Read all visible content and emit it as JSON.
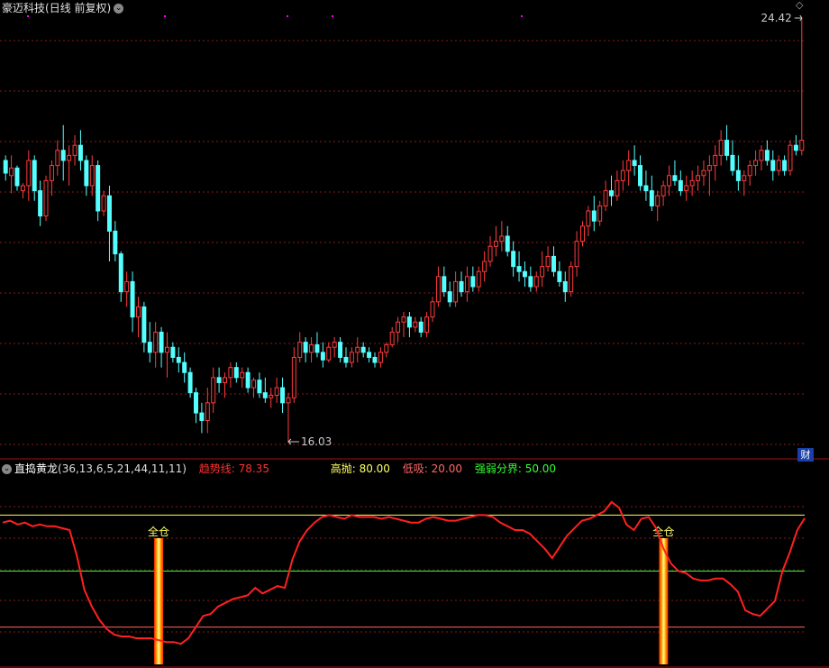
{
  "header": {
    "stock_name": "豪迈科技",
    "period_label": "(日线 前复权)",
    "dropdown_icon": "chevron-down-icon"
  },
  "price_chart": {
    "y_min": 16.03,
    "y_max": 24.42,
    "high_label": "24.42",
    "low_label": "16.03",
    "up_color": "#ff3b3b",
    "down_color": "#54ffff",
    "grid_color": "#8a1a1a",
    "magenta_marker_color": "#ff00ff",
    "fin_button_label": "财"
  },
  "indicator": {
    "name": "直捣黄龙",
    "params": "(36,13,6,5,21,44,11,11)",
    "trend_label": "趋势线:",
    "trend_value": "78.35",
    "high_label": "高抛:",
    "high_value": "80.00",
    "low_label": "低吸:",
    "low_value": "20.00",
    "mid_label": "强弱分界:",
    "mid_value": "50.00",
    "signal_label": "全仓",
    "trend_color": "#ff2020",
    "high_color": "#ffff66",
    "low_color": "#ff6666",
    "mid_color": "#33ff33"
  },
  "chart_data": {
    "type": "candlestick",
    "candles_ohlc": [
      [
        21.6,
        21.7,
        21.2,
        21.35
      ],
      [
        21.3,
        21.7,
        20.95,
        21.45
      ],
      [
        21.45,
        21.5,
        21.0,
        21.1
      ],
      [
        21.0,
        21.15,
        20.85,
        21.1
      ],
      [
        21.1,
        21.8,
        20.8,
        21.6
      ],
      [
        21.6,
        21.7,
        20.8,
        21.0
      ],
      [
        21.0,
        21.2,
        20.3,
        20.5
      ],
      [
        20.5,
        21.3,
        20.4,
        21.2
      ],
      [
        21.2,
        21.6,
        20.9,
        21.5
      ],
      [
        21.5,
        22.0,
        21.3,
        21.8
      ],
      [
        21.8,
        22.3,
        21.2,
        21.6
      ],
      [
        21.6,
        21.9,
        21.1,
        21.7
      ],
      [
        21.7,
        22.1,
        21.5,
        21.9
      ],
      [
        21.9,
        22.2,
        21.4,
        21.6
      ],
      [
        21.6,
        21.7,
        20.9,
        21.1
      ],
      [
        21.1,
        21.7,
        20.9,
        21.5
      ],
      [
        21.5,
        21.6,
        20.4,
        20.6
      ],
      [
        20.6,
        21.0,
        20.5,
        20.9
      ],
      [
        20.9,
        21.1,
        19.6,
        20.2
      ],
      [
        20.2,
        20.4,
        19.6,
        19.75
      ],
      [
        19.75,
        19.8,
        18.8,
        19.0
      ],
      [
        19.0,
        19.4,
        18.7,
        19.2
      ],
      [
        19.2,
        19.4,
        18.2,
        18.5
      ],
      [
        18.5,
        18.9,
        18.1,
        18.7
      ],
      [
        18.7,
        18.8,
        17.8,
        18.0
      ],
      [
        18.0,
        18.4,
        17.6,
        17.8
      ],
      [
        17.8,
        18.4,
        17.5,
        18.2
      ],
      [
        18.2,
        18.3,
        17.5,
        17.8
      ],
      [
        17.8,
        18.2,
        17.3,
        17.9
      ],
      [
        17.9,
        18.0,
        17.6,
        17.7
      ],
      [
        17.7,
        17.9,
        17.4,
        17.6
      ],
      [
        17.6,
        17.8,
        17.2,
        17.4
      ],
      [
        17.4,
        17.5,
        16.9,
        17.0
      ],
      [
        17.0,
        17.1,
        16.4,
        16.6
      ],
      [
        16.6,
        16.8,
        16.2,
        16.45
      ],
      [
        16.45,
        17.1,
        16.2,
        16.8
      ],
      [
        16.8,
        17.5,
        16.6,
        17.3
      ],
      [
        17.3,
        17.5,
        17.0,
        17.2
      ],
      [
        17.2,
        17.4,
        16.9,
        17.3
      ],
      [
        17.3,
        17.6,
        17.1,
        17.5
      ],
      [
        17.5,
        17.6,
        17.2,
        17.3
      ],
      [
        17.3,
        17.5,
        17.1,
        17.4
      ],
      [
        17.4,
        17.5,
        17.0,
        17.1
      ],
      [
        17.1,
        17.3,
        16.9,
        17.25
      ],
      [
        17.25,
        17.4,
        16.9,
        17.0
      ],
      [
        17.0,
        17.3,
        16.8,
        16.9
      ],
      [
        16.9,
        17.1,
        16.7,
        16.95
      ],
      [
        16.95,
        17.3,
        16.8,
        17.1
      ],
      [
        17.1,
        17.3,
        16.6,
        16.8
      ],
      [
        16.8,
        17.0,
        16.03,
        16.9
      ],
      [
        16.9,
        17.9,
        16.8,
        17.7
      ],
      [
        17.7,
        18.2,
        17.6,
        18.0
      ],
      [
        18.0,
        18.1,
        17.6,
        17.8
      ],
      [
        17.8,
        18.1,
        17.6,
        17.95
      ],
      [
        17.95,
        18.2,
        17.7,
        17.8
      ],
      [
        17.8,
        18.0,
        17.5,
        17.65
      ],
      [
        17.65,
        18.0,
        17.6,
        17.9
      ],
      [
        17.9,
        18.1,
        17.7,
        18.0
      ],
      [
        18.0,
        18.1,
        17.6,
        17.7
      ],
      [
        17.7,
        17.9,
        17.5,
        17.6
      ],
      [
        17.6,
        17.9,
        17.5,
        17.8
      ],
      [
        17.8,
        18.1,
        17.6,
        17.9
      ],
      [
        17.9,
        18.0,
        17.7,
        17.8
      ],
      [
        17.8,
        17.9,
        17.6,
        17.7
      ],
      [
        17.7,
        17.8,
        17.5,
        17.6
      ],
      [
        17.6,
        17.9,
        17.5,
        17.8
      ],
      [
        17.8,
        18.0,
        17.7,
        17.95
      ],
      [
        17.95,
        18.3,
        17.9,
        18.2
      ],
      [
        18.2,
        18.5,
        18.0,
        18.4
      ],
      [
        18.4,
        18.6,
        18.1,
        18.5
      ],
      [
        18.5,
        18.6,
        18.1,
        18.3
      ],
      [
        18.3,
        18.5,
        18.2,
        18.4
      ],
      [
        18.4,
        18.5,
        18.1,
        18.2
      ],
      [
        18.2,
        18.6,
        18.1,
        18.5
      ],
      [
        18.5,
        18.9,
        18.4,
        18.8
      ],
      [
        18.8,
        19.5,
        18.7,
        19.3
      ],
      [
        19.3,
        19.5,
        18.9,
        19.0
      ],
      [
        19.0,
        19.2,
        18.7,
        18.8
      ],
      [
        18.8,
        19.4,
        18.7,
        19.2
      ],
      [
        19.2,
        19.4,
        18.9,
        19.0
      ],
      [
        19.0,
        19.5,
        18.8,
        19.3
      ],
      [
        19.3,
        19.5,
        19.0,
        19.1
      ],
      [
        19.1,
        19.5,
        19.0,
        19.4
      ],
      [
        19.4,
        19.8,
        19.2,
        19.6
      ],
      [
        19.6,
        20.1,
        19.5,
        19.9
      ],
      [
        19.9,
        20.3,
        19.7,
        20.0
      ],
      [
        20.0,
        20.4,
        19.8,
        20.1
      ],
      [
        20.1,
        20.3,
        19.7,
        19.8
      ],
      [
        19.8,
        20.0,
        19.3,
        19.5
      ],
      [
        19.5,
        19.8,
        19.2,
        19.4
      ],
      [
        19.4,
        19.6,
        19.1,
        19.3
      ],
      [
        19.3,
        19.5,
        19.0,
        19.1
      ],
      [
        19.1,
        19.4,
        19.0,
        19.3
      ],
      [
        19.3,
        19.8,
        19.1,
        19.5
      ],
      [
        19.5,
        19.9,
        19.4,
        19.7
      ],
      [
        19.7,
        19.9,
        19.3,
        19.4
      ],
      [
        19.4,
        19.6,
        19.1,
        19.2
      ],
      [
        19.2,
        19.4,
        18.8,
        19.0
      ],
      [
        19.0,
        19.6,
        18.9,
        19.5
      ],
      [
        19.5,
        20.2,
        19.3,
        20.0
      ],
      [
        20.0,
        20.4,
        19.9,
        20.3
      ],
      [
        20.3,
        20.7,
        20.1,
        20.6
      ],
      [
        20.6,
        20.9,
        20.2,
        20.4
      ],
      [
        20.4,
        20.8,
        20.3,
        20.7
      ],
      [
        20.7,
        21.2,
        20.6,
        21.0
      ],
      [
        21.0,
        21.3,
        20.7,
        20.9
      ],
      [
        20.9,
        21.4,
        20.8,
        21.2
      ],
      [
        21.2,
        21.6,
        21.0,
        21.4
      ],
      [
        21.4,
        21.8,
        21.1,
        21.6
      ],
      [
        21.6,
        21.9,
        21.3,
        21.5
      ],
      [
        21.5,
        21.7,
        21.0,
        21.1
      ],
      [
        21.1,
        21.4,
        20.8,
        21.0
      ],
      [
        21.0,
        21.3,
        20.6,
        20.7
      ],
      [
        20.7,
        21.0,
        20.4,
        20.9
      ],
      [
        20.9,
        21.2,
        20.7,
        21.1
      ],
      [
        21.1,
        21.5,
        20.9,
        21.3
      ],
      [
        21.3,
        21.6,
        21.1,
        21.2
      ],
      [
        21.2,
        21.4,
        20.9,
        21.0
      ],
      [
        21.0,
        21.3,
        20.8,
        21.1
      ],
      [
        21.1,
        21.4,
        20.9,
        21.2
      ],
      [
        21.2,
        21.5,
        21.0,
        21.3
      ],
      [
        21.3,
        21.6,
        21.1,
        21.4
      ],
      [
        21.4,
        21.7,
        20.9,
        21.5
      ],
      [
        21.5,
        21.9,
        21.2,
        21.7
      ],
      [
        21.7,
        22.2,
        21.5,
        22.0
      ],
      [
        22.0,
        22.3,
        21.6,
        21.7
      ],
      [
        21.7,
        22.0,
        21.3,
        21.4
      ],
      [
        21.4,
        21.7,
        21.0,
        21.2
      ],
      [
        21.2,
        21.4,
        20.9,
        21.3
      ],
      [
        21.3,
        21.6,
        21.1,
        21.5
      ],
      [
        21.5,
        21.8,
        21.3,
        21.6
      ],
      [
        21.6,
        21.9,
        21.4,
        21.8
      ],
      [
        21.8,
        22.0,
        21.5,
        21.6
      ],
      [
        21.6,
        21.8,
        21.2,
        21.4
      ],
      [
        21.4,
        21.7,
        21.3,
        21.6
      ],
      [
        21.6,
        21.7,
        21.3,
        21.4
      ],
      [
        21.4,
        22.0,
        21.3,
        21.9
      ],
      [
        21.9,
        22.1,
        21.7,
        21.8
      ],
      [
        21.8,
        24.42,
        21.7,
        22.0
      ]
    ],
    "indicator_trend_line": [
      76,
      77,
      75,
      76,
      74,
      75,
      74,
      74,
      73,
      72,
      58,
      40,
      31,
      24,
      19,
      16,
      15,
      15,
      14,
      14,
      14,
      13,
      12,
      12,
      11,
      14,
      20,
      26,
      27,
      31,
      33,
      35,
      36,
      37,
      41,
      38,
      40,
      42,
      41,
      56,
      66,
      72,
      76,
      79,
      80,
      79,
      78,
      80,
      79,
      79,
      79,
      78,
      79,
      78,
      77,
      76,
      76,
      78,
      79,
      78,
      77,
      77,
      78,
      79,
      80,
      80,
      79,
      76,
      74,
      72,
      72,
      70,
      66,
      62,
      57,
      63,
      69,
      73,
      77,
      78,
      80,
      82,
      87,
      84,
      75,
      72,
      78,
      79,
      73,
      62,
      54,
      50,
      49,
      46,
      45,
      45,
      46,
      46,
      43,
      39,
      29,
      27,
      26,
      30,
      34,
      50,
      60,
      72,
      78.35
    ],
    "y_range_indicator": [
      0,
      100
    ],
    "signal_columns_index": [
      21,
      89
    ]
  }
}
